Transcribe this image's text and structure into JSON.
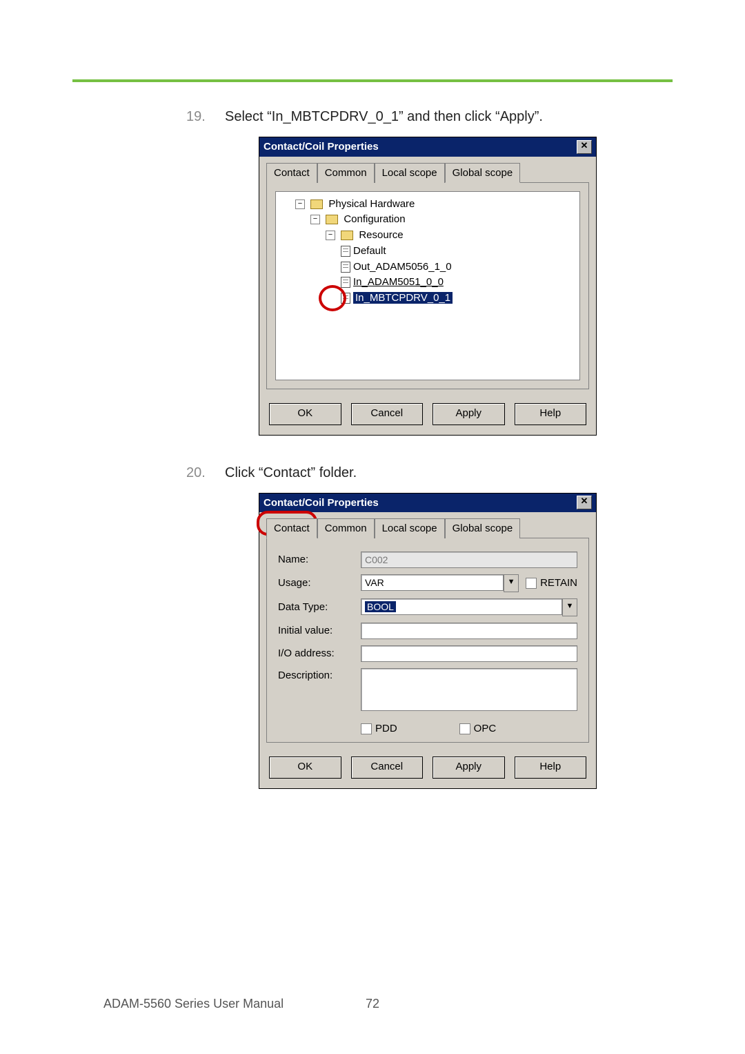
{
  "step19": {
    "num": "19.",
    "text": "Select “In_MBTCPDRV_0_1” and then click “Apply”."
  },
  "step20": {
    "num": "20.",
    "text": "Click “Contact” folder."
  },
  "dlg": {
    "title": "Contact/Coil Properties",
    "close_glyph": "✕",
    "tabs": {
      "contact": "Contact",
      "common": "Common",
      "local": "Local scope",
      "global": "Global scope"
    },
    "tree": {
      "root": "Physical Hardware",
      "config": "Configuration",
      "resource": "Resource",
      "items": [
        "Default",
        "Out_ADAM5056_1_0",
        "In_ADAM5051_0_0",
        "In_MBTCPDRV_0_1"
      ],
      "selected": "In_MBTCPDRV_0_1",
      "twist": "−"
    },
    "buttons": {
      "ok": "OK",
      "cancel": "Cancel",
      "apply": "Apply",
      "help": "Help"
    }
  },
  "dlg2": {
    "labels": {
      "name": "Name:",
      "usage": "Usage:",
      "datatype": "Data Type:",
      "initial": "Initial value:",
      "io": "I/O address:",
      "desc": "Description:"
    },
    "name_value": "C002",
    "usage_value": "VAR",
    "retain": "RETAIN",
    "datatype_value": "BOOL",
    "pdd": "PDD",
    "opc": "OPC",
    "dd_glyph": "▼"
  },
  "footer": {
    "manual": "ADAM-5560 Series User Manual",
    "page": "72"
  }
}
